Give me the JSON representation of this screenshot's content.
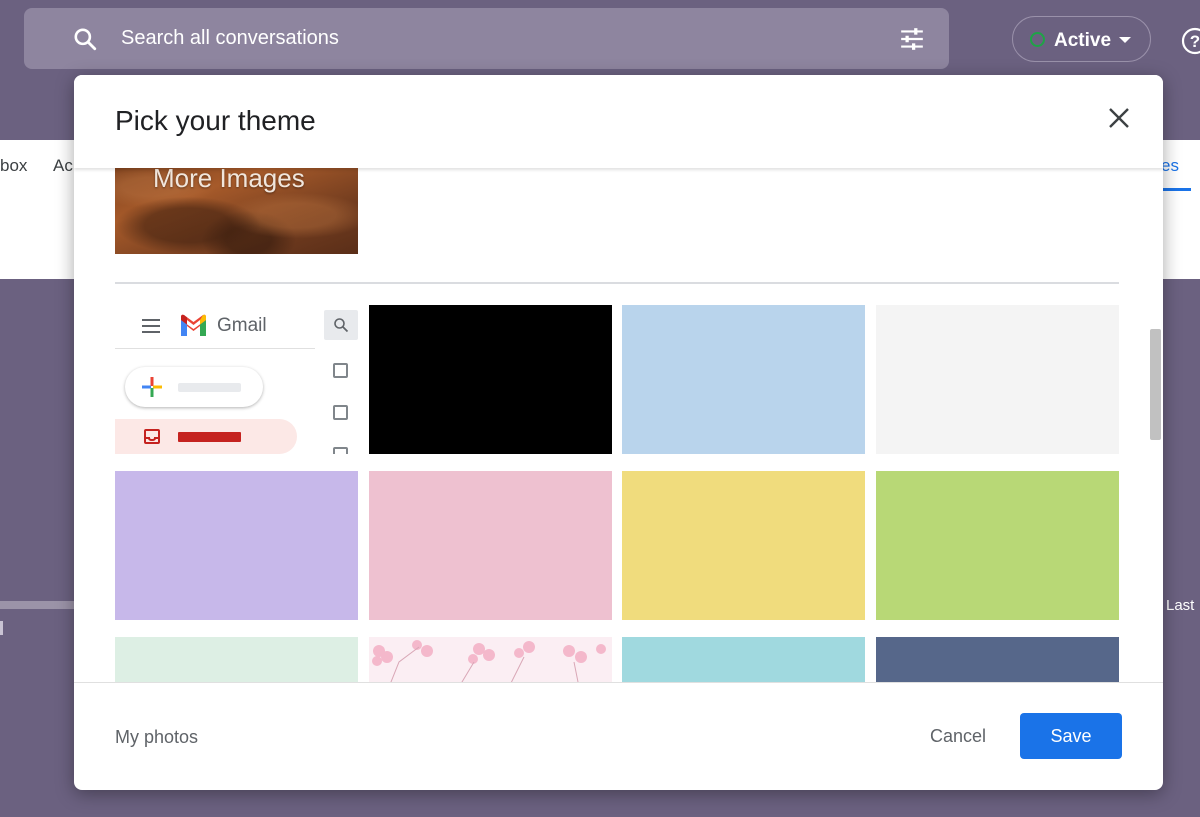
{
  "background": {
    "search_placeholder": "Search all conversations",
    "status_label": "Active",
    "tab_left_1": "box",
    "tab_left_2": "Ac",
    "tab_right": "es",
    "last_label": "Last"
  },
  "dialog": {
    "title": "Pick your theme",
    "more_images_label": "More Images",
    "default_theme": {
      "brand": "Gmail"
    },
    "themes": [
      {
        "name": "black",
        "color": "#000000"
      },
      {
        "name": "light-blue",
        "color": "#b9d4ec"
      },
      {
        "name": "light-gray",
        "color": "#f4f4f4"
      },
      {
        "name": "lavender",
        "color": "#c7b8ea"
      },
      {
        "name": "pink",
        "color": "#eec1d0"
      },
      {
        "name": "yellow",
        "color": "#f0dc7d"
      },
      {
        "name": "green",
        "color": "#b8d876"
      },
      {
        "name": "mint",
        "color": "#ddefe4"
      },
      {
        "name": "cherry-blossom",
        "color": "#fbeef3"
      },
      {
        "name": "teal",
        "color": "#a0d9df"
      },
      {
        "name": "slate-blue",
        "color": "#56678a"
      }
    ],
    "footer": {
      "my_photos": "My photos",
      "cancel": "Cancel",
      "save": "Save"
    }
  },
  "colors": {
    "accent": "#1a73e8",
    "backdrop": "#6b6180",
    "status_green": "#1ea446"
  }
}
